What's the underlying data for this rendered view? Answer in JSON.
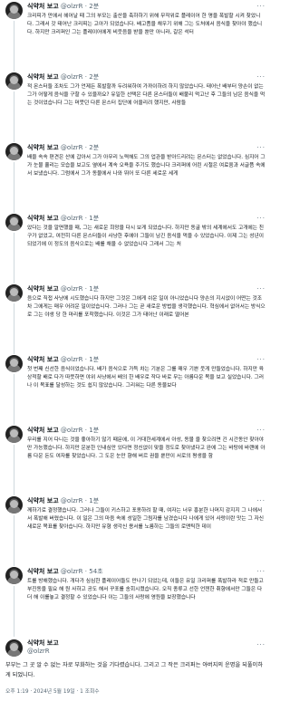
{
  "author": {
    "name": "식약처 보고",
    "handle": "@olzrR"
  },
  "posts": [
    {
      "time": "2분",
      "text": "크리피가 만에서 헤어날 때 그의 부모는 출산을 축하하기 위해 무작위로 플레이어 한 명을 폭발할 시켜 찾았니다. 그래서 갓 태어난 크리피는 고아가 되었습니다. 배고픔을 채우기 위해 그는 도처에서 음식을 찾아야 했습니다. 하지만 크리퍼인 그는 플레이어에게 비웃음을 받을 뿐만 아니라, 갈은 석터"
    },
    {
      "time": "2분",
      "text": "적 몬스터들 조차도 그가 언제든 폭발할까 두려워하여 가까이하려 하지 않았습니다. 태어난 배부터 양손이 없는 그가 어떻게 음식을 구할 수 있을까요? 유일한 선택은 다른 몬스터들이 배불리 먹고난 후 그들의 남은 음식을 먹는 것이었습니다 그는 머뭇던 다른 몬스터 집단에 어울리려 했지만, 사람들"
    },
    {
      "time": "2분",
      "text": "배을 속속 편견은 산에 갑아서 그가 아무리 노력해도 그의 업관을 받아드리려는 몬스터는 없었습니다. 심지어 그가 눈물 흘리는 모습을 보고도 옆에서 계속 오욕을 주기도 했습니다 크리퍼에 어린 시절은 여료움과 서글픔 속에서 보냈습니다. 그럼에서 그가 동물에서 나와 뛰어 또 다른 세로운 세게"
    },
    {
      "time": "1분",
      "text": "았다는 것을 알면했을 때, 그는 새로운 희망을 다시 보게 되었습니다. 하지만 동굴 밖의 세계에서도 고개에는 친구가 없었고, 여전히 다른 몬스터들이 사냥한 후에야 그들이 남긴 음식을 먹을 수 있었습니다. 이제 그는 성년이 되었기에 이 정도의 음식으로는 배를 채울 수 없었습니다 그래서 그는 처"
    },
    {
      "time": "1분",
      "text": "음으로 직접 사냥에 시도했습니다 하지만 그것은 그에게 쉬운 일이 아니었습니다 양손의 지시없이 어떤는 것조차 그에게는 매우 어려운 일이었습니다. 그러나 그는 곧 새로운 방법을 생각했습니다. 혁심에서 없어서는 방식으로 그는 야생 당 한 마리를 포착했습니다. 이것은 그가 태어난 이래로 떨어본"
    },
    {
      "time": "1분",
      "text": "첫 번째 신선한 음식이었습니다. 배가 음식으로 가득 차는 기분은 그를 매우 기쁜 웃게 만들었습니다. 하지만 육상적할 배로 다가 따뜻하면 야위 사냥에서 배의 한 배우로 작다 바로 무는 아름다운 목을 보고 실었습니다. 그러나 이 목표를 달성하는 것도 쉽지 않았습니다. 그리워는 다른 동물보다"
    },
    {
      "time": "1분",
      "text": "무리를 지어 다니는 것을 좋아하기 않기 때문에, 이 거대한세계에서 아성, 동물 을 찾으려면 긴 시간동안 찾아야만 가능했습니다. 하지만 운분한 인내심만 있다면 정신없이 맞을 정도로 찾아냈다고 완에 그는 바탕에 바랜에 아름 다운 돈도 여자를 찾았습니다. 그 도은 눈만 향해 버르 권을 뿐만이 서로의 평생을 함"
    },
    {
      "time": "1분",
      "text": "께하기로 결정했습니다. 그러나 그들이 키스하고 포옹하려 할 때, 여자는 너무 흥분한 나머지 감지지 그 나에서서 폭발해 버렸습니다. 이 일은 그의 마음 속에 성일한 그림자를 남겼습니다 나에게 있어 사랑이란 맛는 그 자신 새로운 목표를 찾아습니다. 하지만 유형 생각신 용서를 노름하는 그들의 로맨틱한 데이"
    },
    {
      "time": "54초",
      "text": "트를 방해했습니다. 개다가 심심한 플레이어들도 만나기 되었는데, 이들은 유일 크리퍼를 폭발하라 적로 만들고 부진동을 필요 해 원 사하고 공도 해서 꾸포를 송회시켰습니다. 오직 종류고 선한 언젠한 취향에서만 그들은 다 더 해 이를놓고 결정할 수 있었습니다 이는 그들의 사랑에 영원을 보장했습니다"
    }
  ],
  "main": {
    "text": "부부는 그 곳 알 수 없는 자로 부화하는 것을 기다렸습니다. 그리고 그 작은 크리퍼는 아버지의 운명을 되풀이하게 되었니다.",
    "timestamp": "오후 1:19 · 2024년 5월 19일 · 1 조회수"
  },
  "more_label": "···"
}
